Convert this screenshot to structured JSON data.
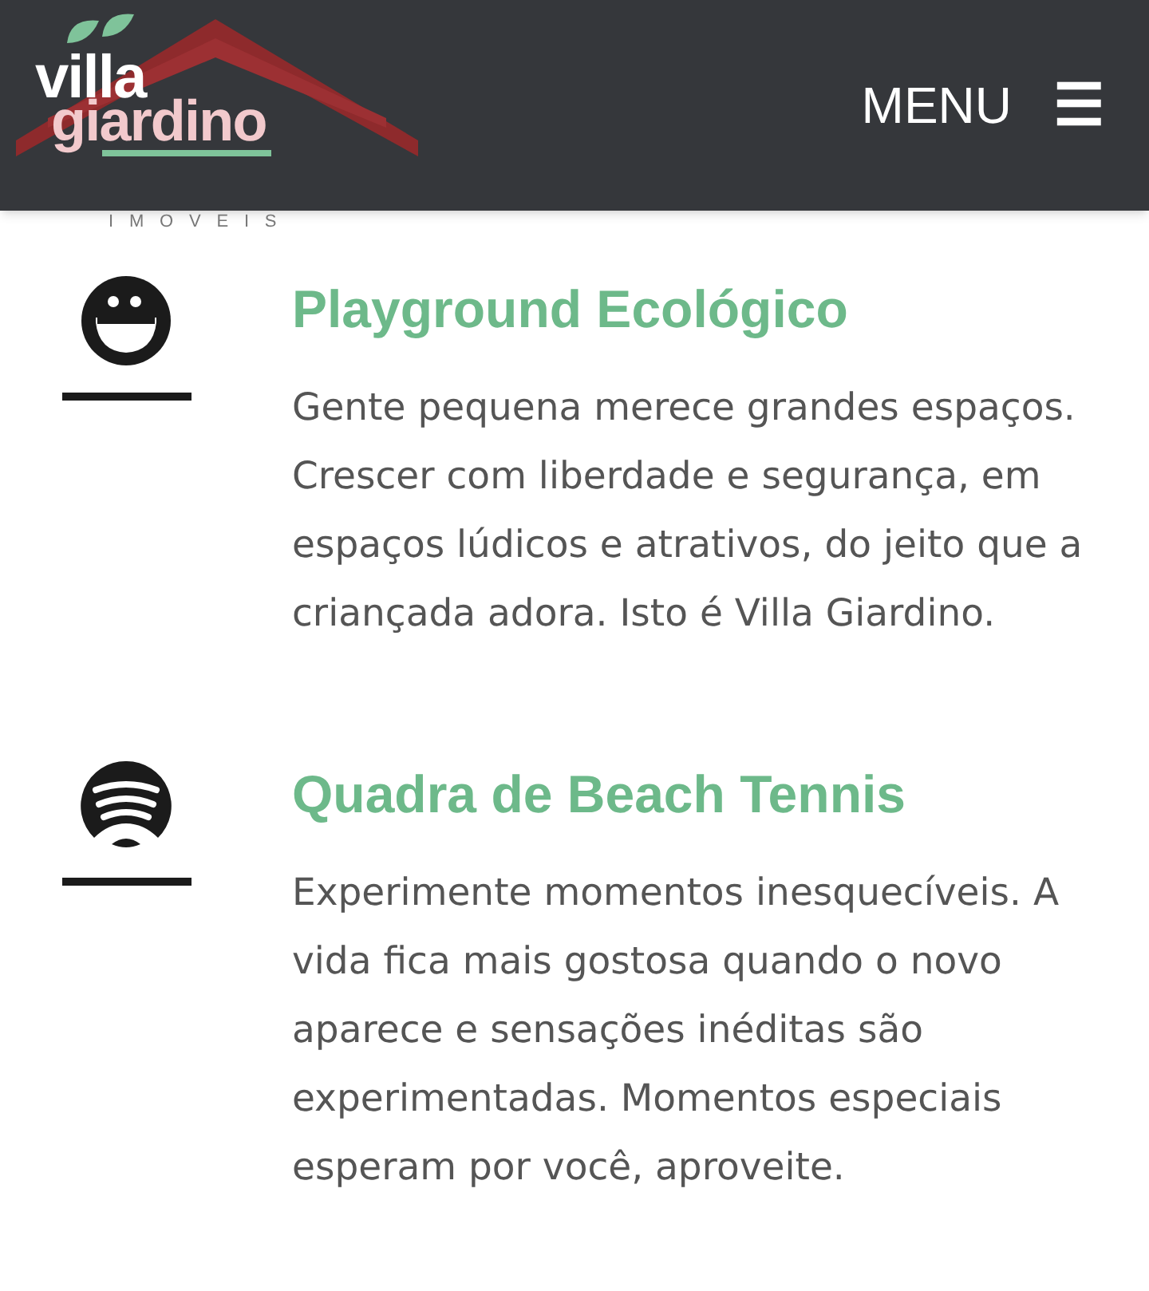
{
  "header": {
    "logo": {
      "line_1": "villa",
      "line_2": "giardino",
      "subtitle": "IMOVEIS"
    },
    "menu_label": "MENU",
    "menu_icon": "☰"
  },
  "features": [
    {
      "kind": "smiley",
      "title": "Playground Ecológico",
      "text": "Gente pequena merece grandes espaços. Crescer com liberdade e segurança, em espaços lúdicos e atrativos, do jeito que a criançada adora. Isto é Villa Giardino."
    },
    {
      "kind": "waves",
      "title": "Quadra de Beach Tennis",
      "text": "Experimente momentos inesquecíveis. A vida fica mais gostosa quando o novo aparece e sensações inéditas são experimentadas. Momentos especiais esperam por você, aproveite."
    }
  ]
}
